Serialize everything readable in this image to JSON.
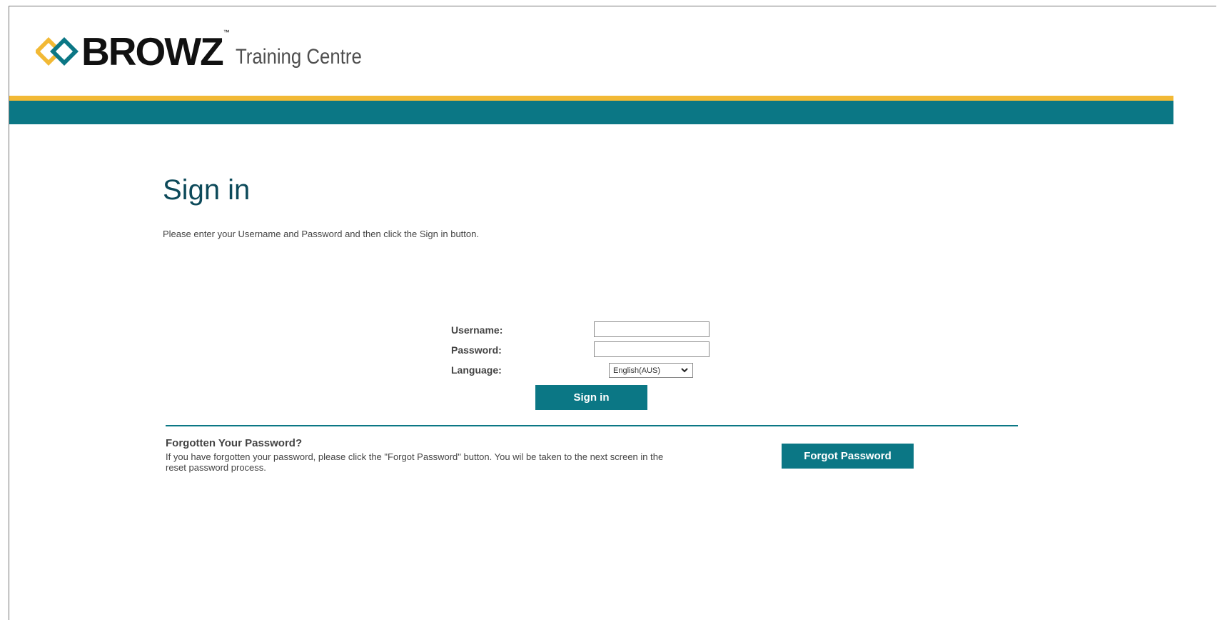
{
  "header": {
    "brand": "BROWZ",
    "trademark": "™",
    "subtitle": "Training Centre",
    "colors": {
      "gold": "#f2b935",
      "teal": "#0b7785"
    }
  },
  "signin": {
    "title": "Sign in",
    "intro": "Please enter your Username and Password and then click the Sign in button.",
    "username_label": "Username:",
    "username_value": "",
    "password_label": "Password:",
    "password_value": "",
    "language_label": "Language:",
    "language_selected": "English(AUS)",
    "button_label": "Sign in"
  },
  "forgot": {
    "title": "Forgotten Your Password?",
    "text": "If you have forgotten your password, please click the \"Forgot Password\" button. You wil be taken to the next screen in the reset password process.",
    "button_label": "Forgot Password"
  },
  "icons": {
    "logo": "browz-diamond-logo-icon",
    "language_dropdown": "chevron-down-icon"
  }
}
